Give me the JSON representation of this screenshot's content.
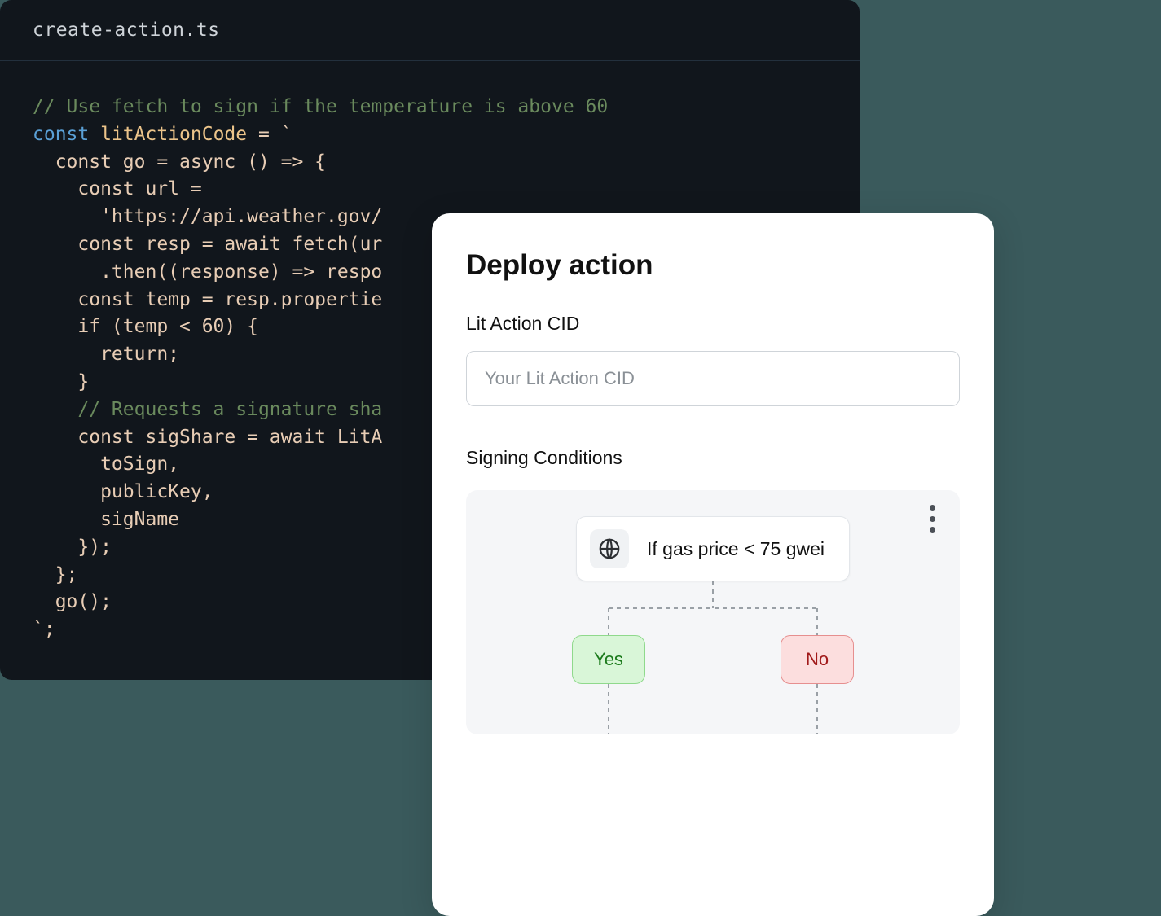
{
  "editor": {
    "filename": "create-action.ts",
    "code": {
      "l1": "// Use fetch to sign if the temperature is above 60",
      "l2a": "const",
      "l2b": "litActionCode",
      "l2c": " = `",
      "l3": "  const go = async () => {",
      "l4": "    const url =",
      "l5": "      'https://api.weather.gov/",
      "l6": "    const resp = await fetch(ur",
      "l7": "      .then((response) => respo",
      "l8": "    const temp = resp.propertie",
      "l9": "    if (temp < 60) {",
      "l10": "      return;",
      "l11": "    }",
      "l12": "    // Requests a signature sha",
      "l13": "    const sigShare = await LitA",
      "l14": "      toSign,",
      "l15": "      publicKey,",
      "l16": "      sigName",
      "l17": "    });",
      "l18": "  };",
      "l19": "  go();",
      "l20": "`;"
    }
  },
  "panel": {
    "title": "Deploy action",
    "cid_label": "Lit Action CID",
    "cid_placeholder": "Your Lit Action CID",
    "cid_value": "",
    "section_label": "Signing Conditions",
    "condition_text": "If gas price < 75 gwei",
    "yes_label": "Yes",
    "no_label": "No"
  }
}
